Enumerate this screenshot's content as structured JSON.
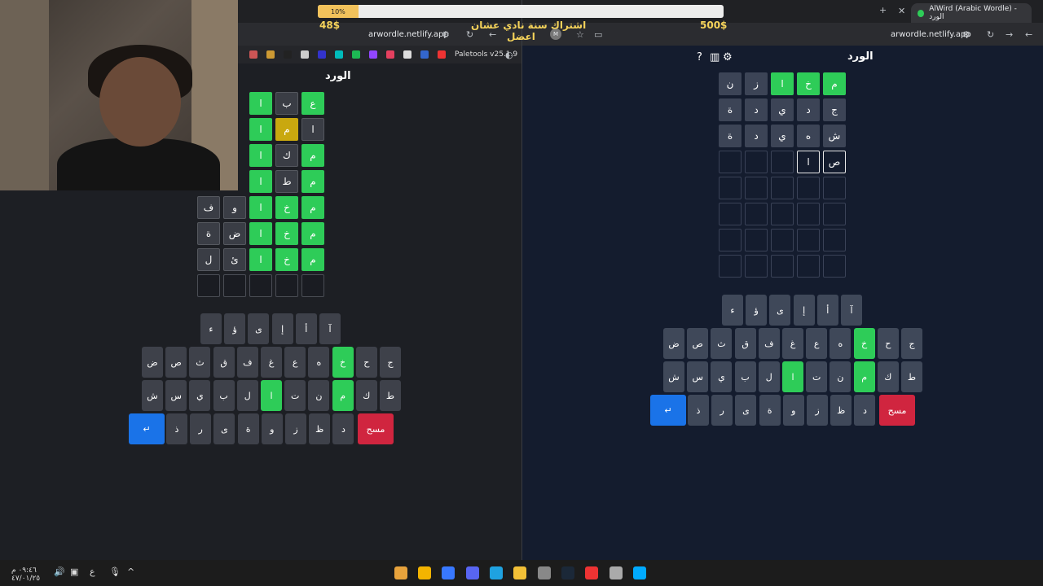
{
  "overlay": {
    "progress_label": "10%",
    "progress": 0.1,
    "left_amount": "48$",
    "right_amount": "500$",
    "message_line1": "اشتراك سنة نادي عشان",
    "message_line2": "اعضل"
  },
  "left_browser": {
    "url": "arwordle.netlify.app",
    "extension_label": "Paletools v25.1.9",
    "game_title": "الورد",
    "grid": [
      [
        "ع",
        "ب",
        "ا",
        "",
        ""
      ],
      [
        "ا",
        "م",
        "ا",
        "",
        ""
      ],
      [
        "م",
        "ك",
        "ا",
        "",
        ""
      ],
      [
        "م",
        "ط",
        "ا",
        "",
        ""
      ],
      [
        "م",
        "خ",
        "ا",
        "و",
        "ف"
      ],
      [
        "م",
        "خ",
        "ا",
        "ض",
        "ة"
      ],
      [
        "م",
        "خ",
        "ا",
        "ئ",
        "ل"
      ],
      [
        "",
        "",
        "",
        "",
        ""
      ]
    ],
    "keys_row1": [
      "آ",
      "أ",
      "إ",
      "ى",
      "ؤ",
      "ء"
    ],
    "keys_row2": [
      "ج",
      "ح",
      "خ",
      "ه",
      "ع",
      "غ",
      "ف",
      "ق",
      "ث",
      "ص",
      "ض"
    ],
    "keys_row3": [
      "ط",
      "ك",
      "م",
      "ن",
      "ت",
      "ا",
      "ل",
      "ب",
      "ي",
      "س",
      "ش"
    ],
    "keys_row4_enter": "↵",
    "keys_row4": [
      "ذ",
      "ر",
      "ى",
      "ة",
      "و",
      "ز",
      "ظ",
      "د"
    ],
    "delete_label": "مسح"
  },
  "right_browser": {
    "url": "arwordle.netlify.app",
    "tab_title": "AlWird (Arabic Wordle) - الورد",
    "game_title": "الورد",
    "grid": [
      [
        "م",
        "خ",
        "ا",
        "ز",
        "ن"
      ],
      [
        "ج",
        "د",
        "ي",
        "د",
        "ة"
      ],
      [
        "ش",
        "ه",
        "ي",
        "د",
        "ة"
      ],
      [
        "ص",
        "ا",
        "",
        "",
        ""
      ],
      [
        "",
        "",
        "",
        "",
        ""
      ],
      [
        "",
        "",
        "",
        "",
        ""
      ],
      [
        "",
        "",
        "",
        "",
        ""
      ],
      [
        "",
        "",
        "",
        "",
        ""
      ]
    ],
    "keys_row1": [
      "آ",
      "أ",
      "إ",
      "ى",
      "ؤ",
      "ء"
    ],
    "keys_row2": [
      "ج",
      "ح",
      "خ",
      "ه",
      "ع",
      "غ",
      "ف",
      "ق",
      "ث",
      "ص",
      "ض"
    ],
    "keys_row3": [
      "ط",
      "ك",
      "م",
      "ن",
      "ت",
      "ا",
      "ل",
      "ب",
      "ي",
      "س",
      "ش"
    ],
    "keys_row4_enter": "↵",
    "keys_row4": [
      "ذ",
      "ر",
      "ى",
      "ة",
      "و",
      "ز",
      "ظ",
      "د"
    ],
    "delete_label": "مسح"
  },
  "taskbar": {
    "clock_time": "٠٩:٤٦ م",
    "clock_date": "٤٧/٠١/٢٥",
    "lang": "ع"
  },
  "colors": {
    "green": "#2ecc58",
    "yellow": "#c9a80f",
    "enter": "#1a73e8",
    "delete": "#d0253f"
  }
}
